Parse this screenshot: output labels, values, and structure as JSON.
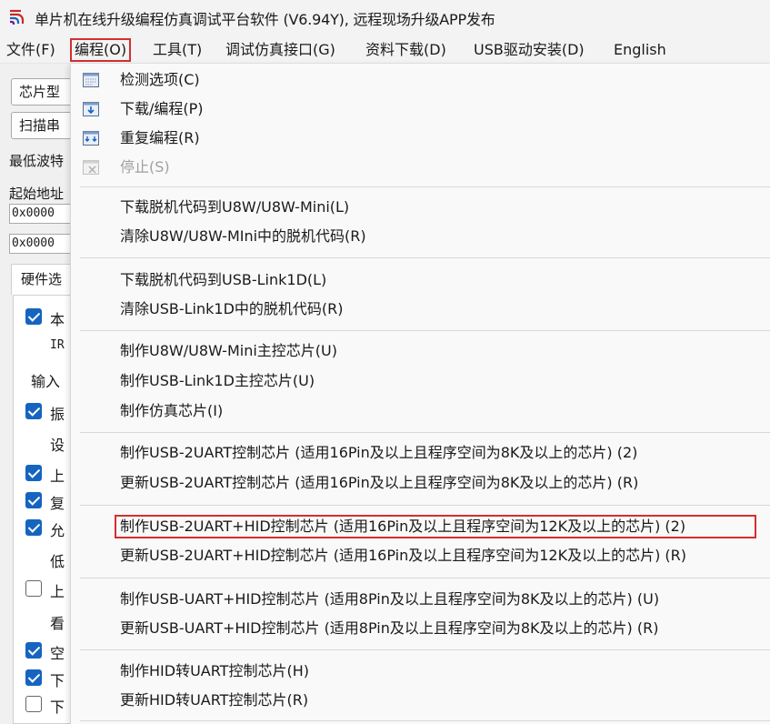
{
  "window": {
    "title": "单片机在线升级编程仿真调试平台软件 (V6.94Y), 远程现场升级APP发布"
  },
  "menubar": [
    {
      "label": "文件(F)",
      "active": false
    },
    {
      "label": "编程(O)",
      "active": true
    },
    {
      "label": "工具(T)",
      "active": false
    },
    {
      "label": "调试仿真接口(G)",
      "active": false
    },
    {
      "label": "资料下载(D)",
      "active": false
    },
    {
      "label": "USB驱动安装(D)",
      "active": false
    },
    {
      "label": "English",
      "active": false
    }
  ],
  "left_panel": {
    "chip_type_btn": "芯片型",
    "scan_port_btn": "扫描串",
    "min_baud_label": "最低波特",
    "start_addr_label": "起始地址",
    "addr1_value": "0x0000",
    "addr2_value": "0x0000",
    "hw_tab": "硬件选",
    "options": [
      {
        "label": "本",
        "checked": true
      },
      {
        "label": "IR",
        "checkbox": false
      },
      {
        "label": "输入",
        "checkbox": false
      },
      {
        "label": "振",
        "checked": true
      },
      {
        "label": "设",
        "checkbox": false
      },
      {
        "label": "上",
        "checked": true
      },
      {
        "label": "复",
        "checked": true
      },
      {
        "label": "允",
        "checked": true
      },
      {
        "label": "低",
        "checkbox": false
      },
      {
        "label": "上",
        "checked": false
      },
      {
        "label": "看",
        "checkbox": false
      },
      {
        "label": "空",
        "checked": true
      },
      {
        "label": "下",
        "checked": true
      },
      {
        "label": "下",
        "checked": false
      }
    ]
  },
  "dropdown": {
    "items": [
      {
        "label": "检测选项(C)",
        "icon": "detect-options-icon"
      },
      {
        "label": "下载/编程(P)",
        "icon": "download-program-icon"
      },
      {
        "label": "重复编程(R)",
        "icon": "repeat-program-icon"
      },
      {
        "label": "停止(S)",
        "icon": "stop-icon",
        "disabled": true
      },
      {
        "label": "下载脱机代码到U8W/U8W-Mini(L)"
      },
      {
        "label": "清除U8W/U8W-MIni中的脱机代码(R)"
      },
      {
        "label": "下载脱机代码到USB-Link1D(L)"
      },
      {
        "label": "清除USB-Link1D中的脱机代码(R)"
      },
      {
        "label": "制作U8W/U8W-Mini主控芯片(U)"
      },
      {
        "label": "制作USB-Link1D主控芯片(U)"
      },
      {
        "label": "制作仿真芯片(I)"
      },
      {
        "label": "制作USB-2UART控制芯片 (适用16Pin及以上且程序空间为8K及以上的芯片) (2)"
      },
      {
        "label": "更新USB-2UART控制芯片 (适用16Pin及以上且程序空间为8K及以上的芯片) (R)"
      },
      {
        "label": "制作USB-2UART+HID控制芯片 (适用16Pin及以上且程序空间为12K及以上的芯片) (2)",
        "highlighted": true
      },
      {
        "label": "更新USB-2UART+HID控制芯片 (适用16Pin及以上且程序空间为12K及以上的芯片) (R)"
      },
      {
        "label": "制作USB-UART+HID控制芯片 (适用8Pin及以上且程序空间为8K及以上的芯片) (U)"
      },
      {
        "label": "更新USB-UART+HID控制芯片 (适用8Pin及以上且程序空间为8K及以上的芯片) (R)"
      },
      {
        "label": "制作HID转UART控制芯片(H)"
      },
      {
        "label": "更新HID转UART控制芯片(R)"
      }
    ]
  },
  "colors": {
    "highlight_border": "#d32f2f",
    "checkbox_checked": "#1565c0"
  }
}
